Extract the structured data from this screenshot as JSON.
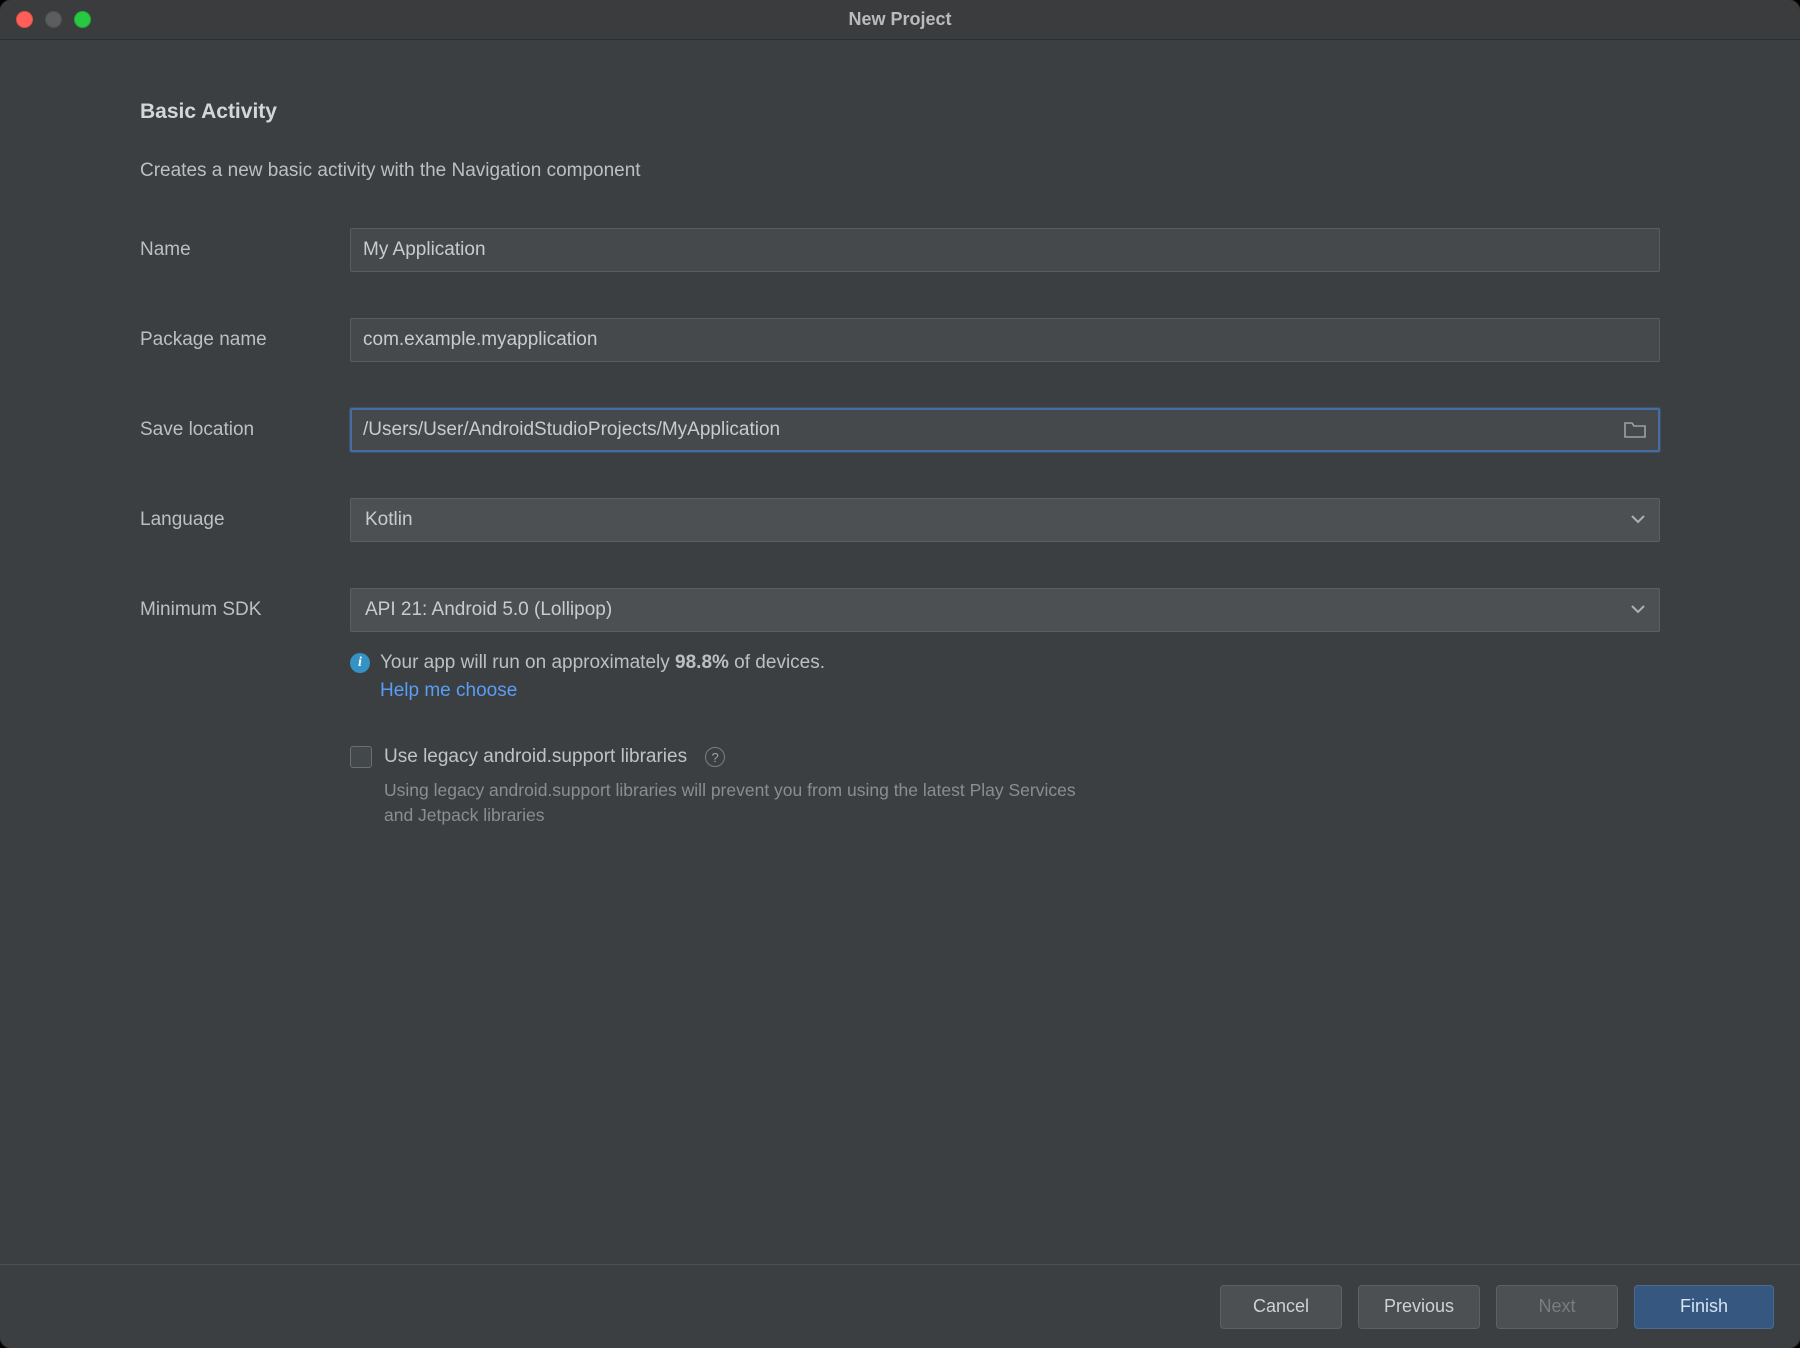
{
  "window": {
    "title": "New Project"
  },
  "heading": "Basic Activity",
  "subheading": "Creates a new basic activity with the Navigation component",
  "labels": {
    "name": "Name",
    "package": "Package name",
    "location": "Save location",
    "language": "Language",
    "minsdk": "Minimum SDK"
  },
  "fields": {
    "name": "My Application",
    "package": "com.example.myapplication",
    "location": "/Users/User/AndroidStudioProjects/MyApplication",
    "language": "Kotlin",
    "minsdk": "API 21: Android 5.0 (Lollipop)"
  },
  "info": {
    "pre_text": "Your app will run on approximately ",
    "pct": "98.8%",
    "post_text": " of devices.",
    "help_link": "Help me choose"
  },
  "legacy": {
    "label": "Use legacy android.support libraries",
    "note": "Using legacy android.support libraries will prevent you from using the latest Play Services and Jetpack libraries"
  },
  "buttons": {
    "cancel": "Cancel",
    "previous": "Previous",
    "next": "Next",
    "finish": "Finish"
  }
}
